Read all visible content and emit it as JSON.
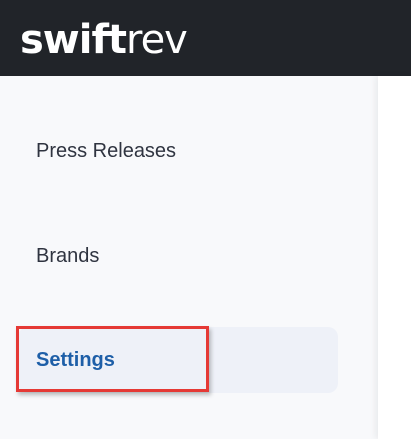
{
  "brand": {
    "logo_part_bold": "swift",
    "logo_part_light": "rev"
  },
  "sidebar": {
    "items": [
      {
        "label": "Press Releases",
        "active": false
      },
      {
        "label": "Brands",
        "active": false
      },
      {
        "label": "Settings",
        "active": true
      }
    ]
  },
  "colors": {
    "topbar": "#212429",
    "active_text": "#1e5fa8",
    "active_bg": "#eef1f8",
    "highlight_border": "#e53935"
  }
}
